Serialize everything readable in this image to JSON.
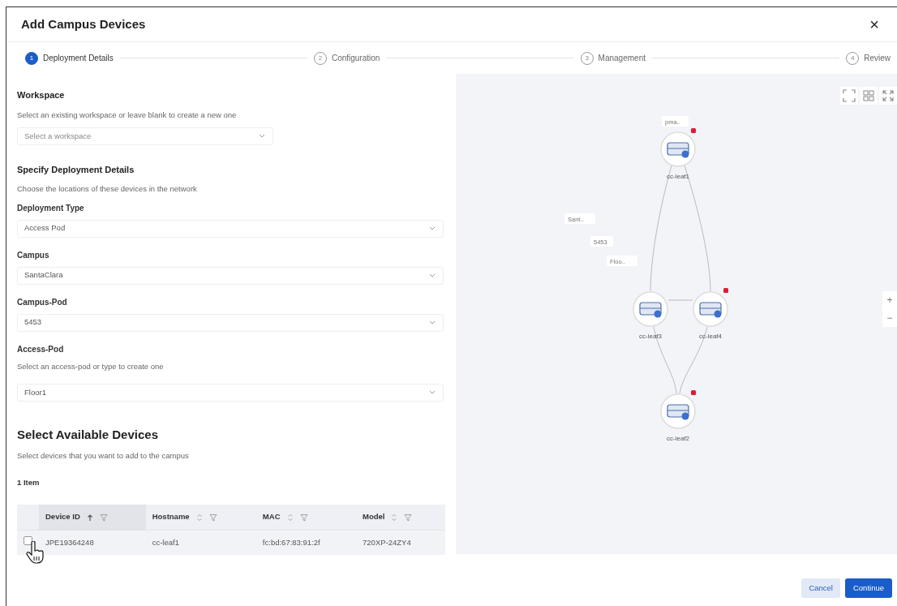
{
  "dialog": {
    "title": "Add Campus Devices",
    "close": "×"
  },
  "steps": [
    {
      "number": "1",
      "label": "Deployment Details",
      "selected": true
    },
    {
      "number": "2",
      "label": "Configuration",
      "selected": false
    },
    {
      "number": "3",
      "label": "Management",
      "selected": false
    },
    {
      "number": "4",
      "label": "Review",
      "selected": false
    }
  ],
  "form": {
    "sections": [
      {
        "kind": "group",
        "title": "Workspace",
        "description": "Select an existing workspace or leave blank to create a new one",
        "fields": [
          {
            "placeholder": "Select a workspace",
            "narrow": true
          }
        ]
      },
      {
        "kind": "group",
        "title": "Specify Deployment Details",
        "description": "Choose the locations of these devices in the network",
        "fields": [
          {
            "label": "Deployment Type",
            "value": "Access Pod"
          },
          {
            "label": "Campus",
            "value": "SantaClara"
          },
          {
            "label": "Campus-Pod",
            "value": "5453"
          },
          {
            "label": "Access-Pod",
            "hint": "Select an access-pod or type to create one",
            "value": "Floor1"
          }
        ]
      }
    ]
  },
  "devices": {
    "title": "Select Available Devices",
    "description": "Select devices that you want to add to the campus",
    "count": "1 Item",
    "columns": [
      {
        "label": "Device ID",
        "sorted": true
      },
      {
        "label": "Hostname",
        "sorted": false
      },
      {
        "label": "MAC",
        "sorted": false
      },
      {
        "label": "Model",
        "sorted": false
      }
    ],
    "rows": [
      {
        "selected": false,
        "cells": [
          "JPE19364248",
          "cc-leaf1",
          "fc:bd:67:83:91:2f",
          "720XP-24ZY4"
        ]
      }
    ]
  },
  "topology": {
    "tags": [
      "pma..",
      "Sant..",
      "5453",
      "Floo.."
    ],
    "nodes": [
      {
        "name": "cc-leaf1",
        "alert": true
      },
      {
        "name": "cc-leaf3",
        "alert": false
      },
      {
        "name": "cc-leaf4",
        "alert": true
      },
      {
        "name": "cc-leaf2",
        "alert": true
      }
    ],
    "zoom": [
      "+",
      "−"
    ]
  },
  "buttons": [
    {
      "label": "Cancel",
      "kind": "secondary"
    },
    {
      "label": "Continue",
      "kind": "primary"
    }
  ]
}
